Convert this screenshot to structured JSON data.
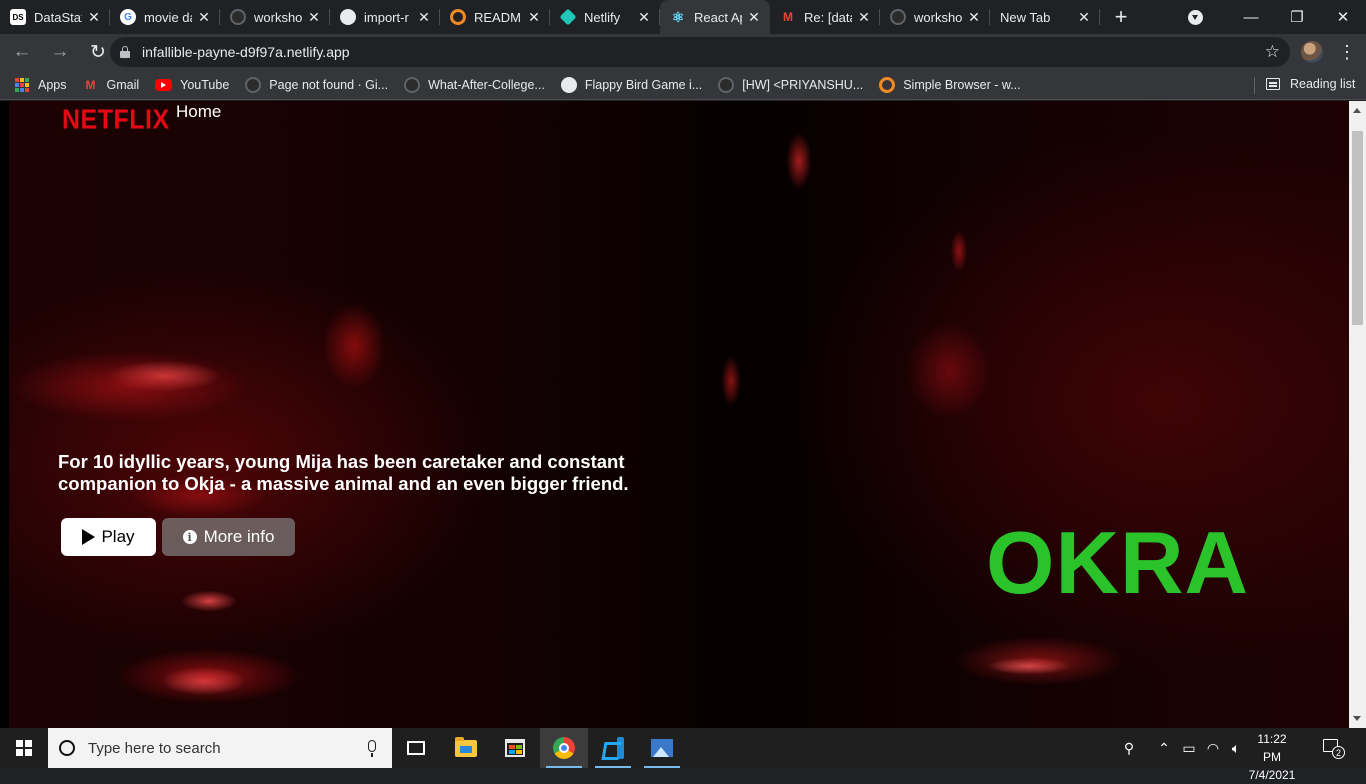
{
  "browser": {
    "tabs": [
      {
        "title": "DataStax",
        "icon": "datastax-icon",
        "favicon_text": "DS",
        "active": false
      },
      {
        "title": "movie da",
        "icon": "google-icon",
        "favicon_text": "G",
        "active": false
      },
      {
        "title": "worksho",
        "icon": "github-icon",
        "favicon_text": "",
        "active": false
      },
      {
        "title": "import-r",
        "icon": "globe-icon",
        "favicon_text": "",
        "active": false
      },
      {
        "title": "README",
        "icon": "gitbook-icon",
        "favicon_text": "",
        "active": false
      },
      {
        "title": "Netlify",
        "icon": "netlify-icon",
        "favicon_text": "",
        "active": false
      },
      {
        "title": "React Ap",
        "icon": "react-icon",
        "favicon_text": "⚛",
        "active": true
      },
      {
        "title": "Re: [data",
        "icon": "gmail-icon",
        "favicon_text": "M",
        "active": false
      },
      {
        "title": "worksho",
        "icon": "github-icon",
        "favicon_text": "",
        "active": false
      },
      {
        "title": "New Tab",
        "icon": "",
        "favicon_text": "",
        "active": false
      }
    ],
    "new_tab_symbol": "+",
    "window_controls": {
      "minimize": "—",
      "restore": "❐",
      "close": "✕"
    },
    "url": "infallible-payne-d9f97a.netlify.app",
    "bookmarks": [
      {
        "label": "Apps",
        "icon": "apps-grid-icon"
      },
      {
        "label": "Gmail",
        "icon": "gmail-icon"
      },
      {
        "label": "YouTube",
        "icon": "youtube-icon"
      },
      {
        "label": "Page not found · Gi...",
        "icon": "github-icon"
      },
      {
        "label": "What-After-College...",
        "icon": "github-icon"
      },
      {
        "label": "Flappy Bird Game i...",
        "icon": "globe-icon"
      },
      {
        "label": "[HW] <PRIYANSHU...",
        "icon": "github-icon"
      },
      {
        "label": "Simple Browser - w...",
        "icon": "gitbook-icon"
      }
    ],
    "reading_list": "Reading list"
  },
  "page": {
    "logo": "NETFLIX",
    "nav_home": "Home",
    "description": "For 10 idyllic years, young Mija has been caretaker and constant companion to Okja - a massive animal and an even bigger friend.",
    "play_label": "Play",
    "more_info_label": "More info",
    "movie_title": "OKRA",
    "colors": {
      "logo_red": "#e50914",
      "title_green": "#2ac42a"
    }
  },
  "taskbar": {
    "search_placeholder": "Type here to search",
    "time": "11:22 PM",
    "date": "7/4/2021",
    "notification_count": "2"
  }
}
